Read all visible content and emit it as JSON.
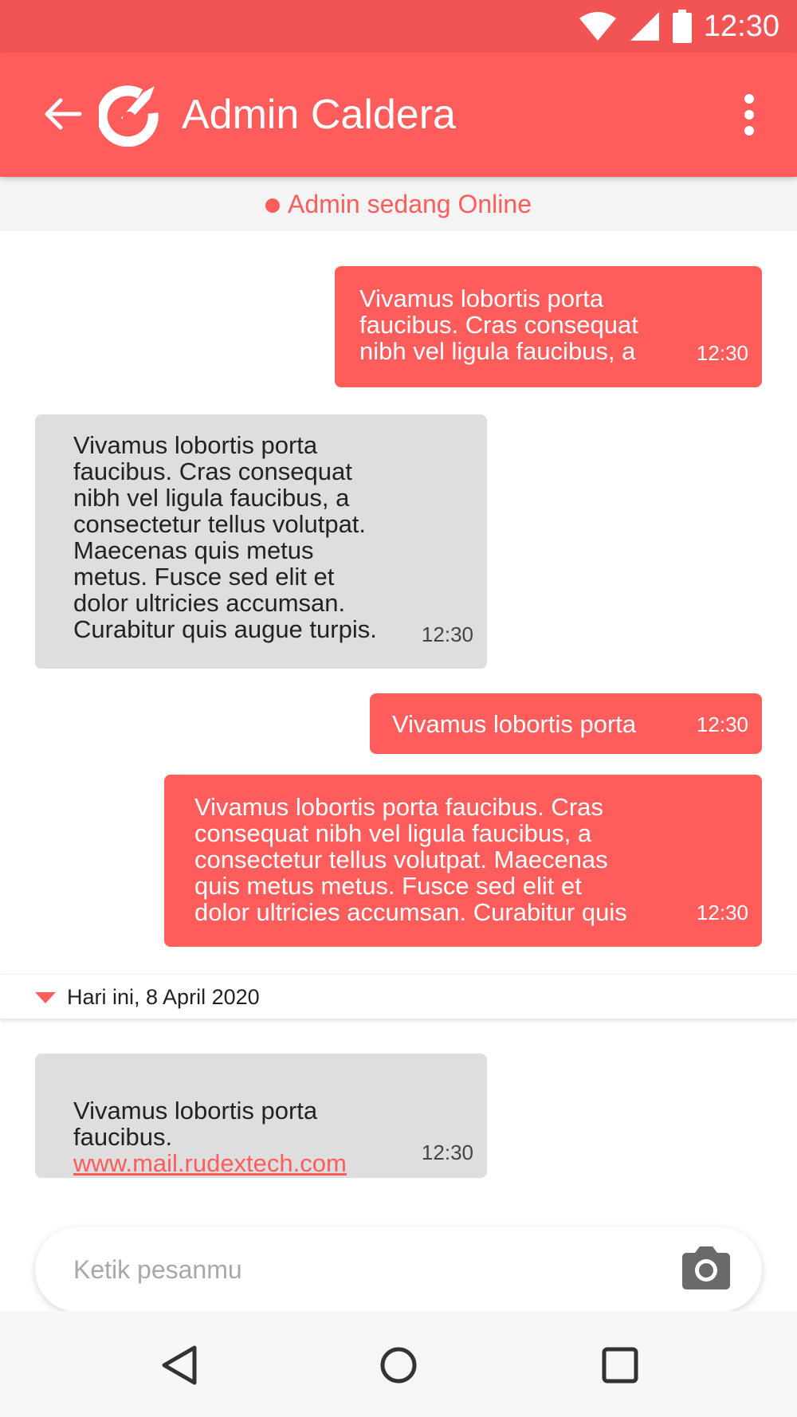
{
  "status_bar": {
    "time": "12:30",
    "icons": [
      "wifi-icon",
      "signal-icon",
      "battery-icon"
    ]
  },
  "app_bar": {
    "title": "Admin Caldera",
    "icons": [
      "back-arrow-icon",
      "caldera-logo-icon",
      "more-vert-icon"
    ]
  },
  "online_status": {
    "text": "Admin sedang Online"
  },
  "messages": [
    {
      "direction": "out",
      "text": "Vivamus lobortis porta\nfaucibus. Cras consequat\nnibh vel ligula faucibus, a",
      "time": "12:30"
    },
    {
      "direction": "in",
      "text": "Vivamus lobortis porta\nfaucibus. Cras consequat\nnibh vel ligula faucibus, a\nconsectetur tellus volutpat.\nMaecenas quis metus\nmetus. Fusce sed elit et\ndolor ultricies accumsan.\nCurabitur quis augue turpis.",
      "time": "12:30"
    },
    {
      "direction": "out",
      "text": "Vivamus lobortis porta",
      "time": "12:30"
    },
    {
      "direction": "out",
      "text": "Vivamus lobortis porta faucibus. Cras\nconsequat nibh vel ligula faucibus, a\nconsectetur tellus volutpat. Maecenas\nquis metus metus. Fusce sed elit et\ndolor ultricies accumsan. Curabitur quis",
      "time": "12:30"
    },
    {
      "direction": "in",
      "text": "Vivamus lobortis porta\nfaucibus.",
      "link": "www.mail.rudextech.com",
      "time": "12:30"
    }
  ],
  "date_separator": {
    "text": "Hari ini, 8 April 2020"
  },
  "composer": {
    "placeholder": "Ketik pesanmu",
    "value": "",
    "icon": "camera-icon"
  },
  "nav_bar": {
    "icons": [
      "back-triangle-icon",
      "home-circle-icon",
      "recents-square-icon"
    ]
  },
  "colors": {
    "primary": "#ff5c5c",
    "status_bar": "#f25454",
    "incoming_bubble": "#dedede",
    "outgoing_bubble": "#ff5c5c"
  }
}
